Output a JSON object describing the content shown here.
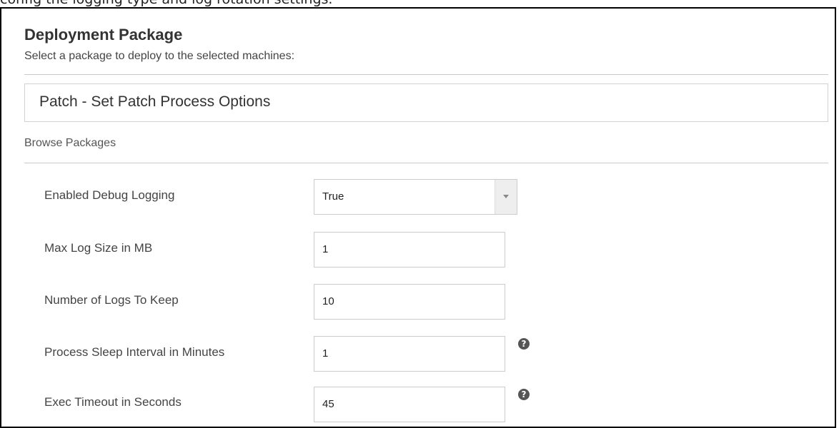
{
  "caption": "config the logging type and log rotation settings.",
  "panel": {
    "title": "Deployment Package",
    "subtitle": "Select a package to deploy to the selected machines:"
  },
  "package": {
    "selected": "Patch - Set Patch Process Options",
    "browse_label": "Browse Packages"
  },
  "fields": [
    {
      "label": "Enabled Debug Logging",
      "value": "True",
      "type": "select"
    },
    {
      "label": "Max Log Size in MB",
      "value": "1",
      "type": "text"
    },
    {
      "label": "Number of Logs To Keep",
      "value": "10",
      "type": "text"
    },
    {
      "label": "Process Sleep Interval in Minutes",
      "value": "1",
      "type": "text",
      "help": "?"
    },
    {
      "label": "Exec Timeout in Seconds",
      "value": "45",
      "type": "text",
      "help": "?"
    }
  ]
}
